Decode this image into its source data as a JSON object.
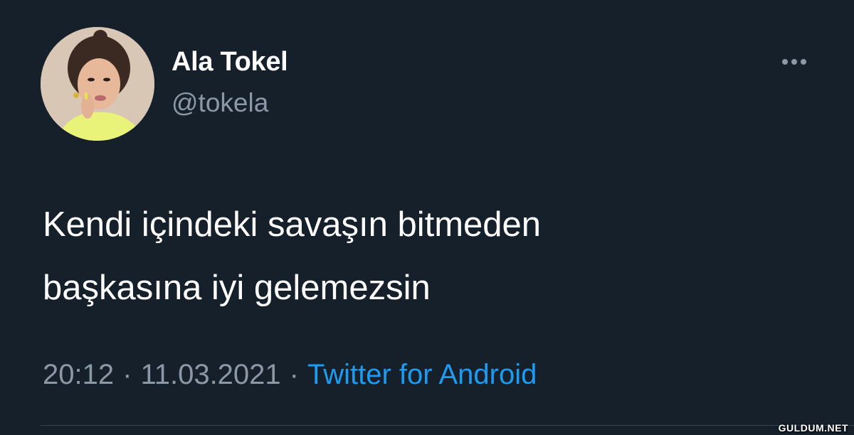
{
  "tweet": {
    "display_name": "Ala Tokel",
    "handle": "@tokela",
    "text_lines": [
      "Kendi içindeki savaşın bitmeden",
      "başkasına iyi gelemezsin"
    ],
    "time": "20:12",
    "separator": "·",
    "date": "11.03.2021",
    "source": "Twitter for Android",
    "more_icon": "more-horizontal-icon"
  },
  "watermark": "GULDUM.NET",
  "colors": {
    "background": "#15202b",
    "primary_text": "#ffffff",
    "secondary_text": "#8b98a5",
    "accent": "#1d9bf0",
    "divider": "#38444d"
  }
}
